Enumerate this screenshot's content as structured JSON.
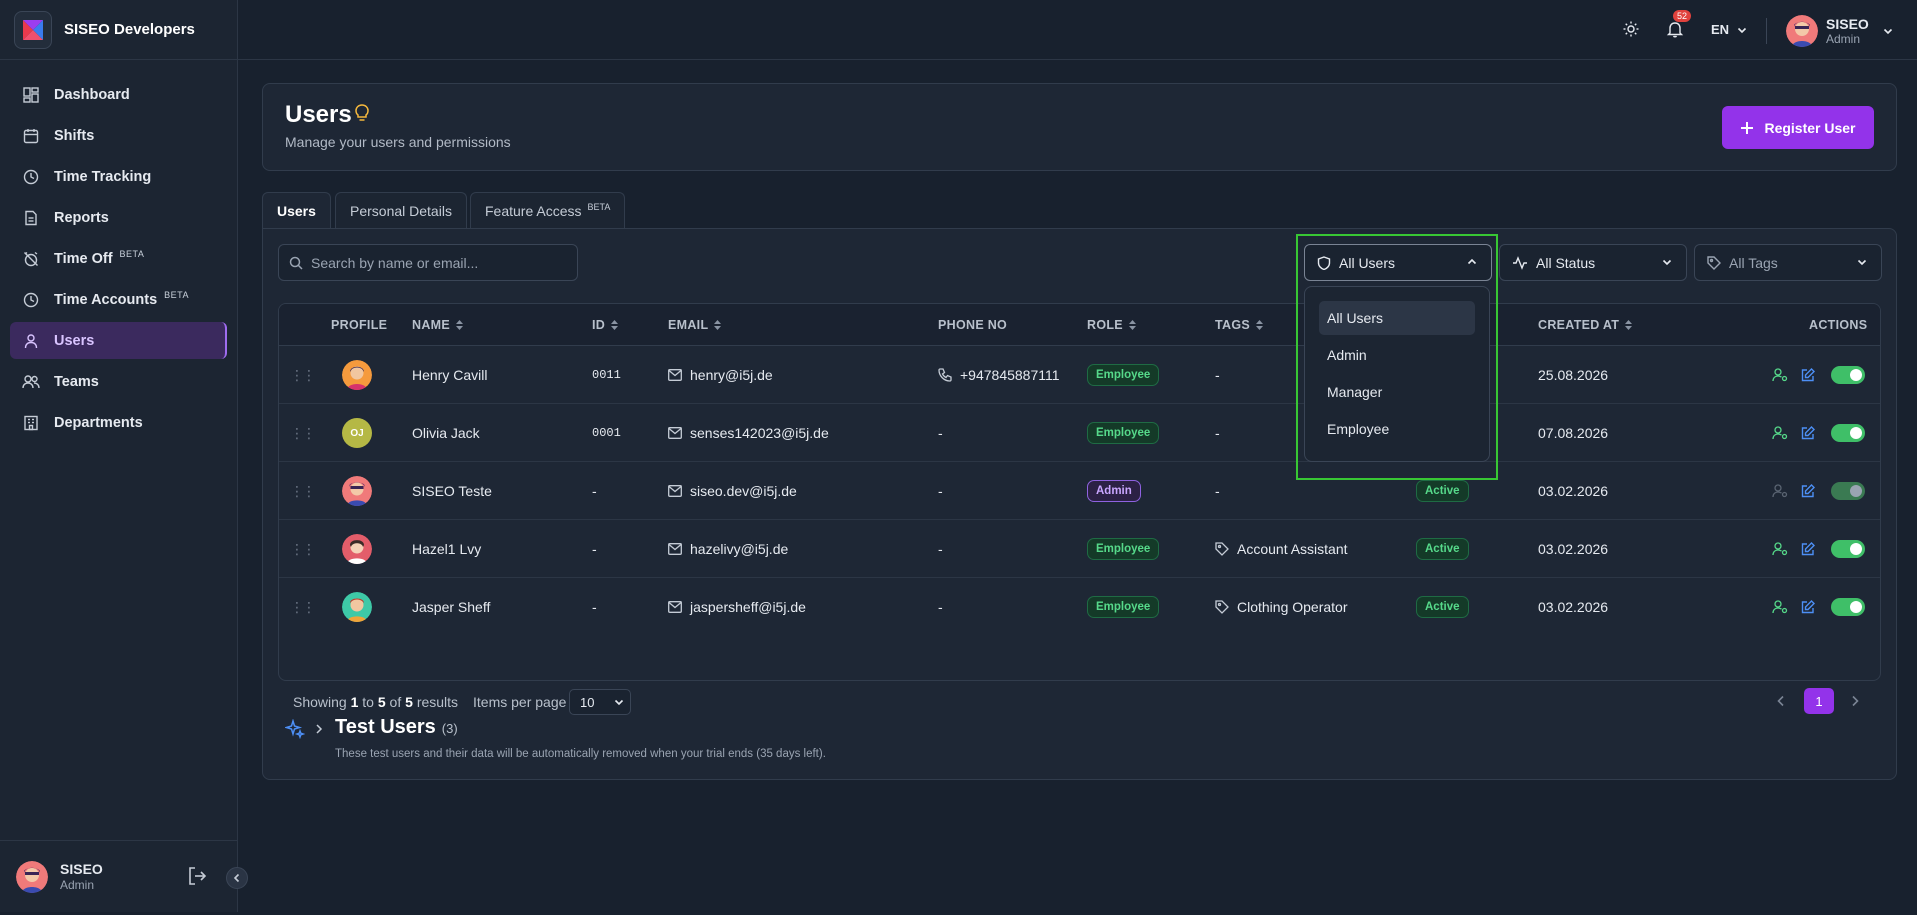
{
  "app": {
    "name": "SISEO Developers"
  },
  "sidebar": {
    "items": [
      {
        "label": "Dashboard",
        "icon": "grid-icon"
      },
      {
        "label": "Shifts",
        "icon": "calendar-icon"
      },
      {
        "label": "Time Tracking",
        "icon": "clock-icon"
      },
      {
        "label": "Reports",
        "icon": "file-icon"
      },
      {
        "label": "Time Off",
        "badge": "BETA",
        "icon": "alarm-off-icon"
      },
      {
        "label": "Time Accounts",
        "badge": "BETA",
        "icon": "clock-icon"
      },
      {
        "label": "Users",
        "icon": "user-icon",
        "active": true
      },
      {
        "label": "Teams",
        "icon": "users-icon"
      },
      {
        "label": "Departments",
        "icon": "building-icon"
      }
    ],
    "footer": {
      "name": "SISEO",
      "role": "Admin"
    }
  },
  "topbar": {
    "notifications": "52",
    "language": "EN",
    "user": {
      "name": "SISEO",
      "role": "Admin"
    }
  },
  "header": {
    "title": "Users",
    "subtitle": "Manage your users and permissions",
    "register_label": "Register User"
  },
  "tabs": [
    {
      "label": "Users",
      "active": true
    },
    {
      "label": "Personal Details"
    },
    {
      "label": "Feature Access",
      "badge": "BETA"
    }
  ],
  "filters": {
    "search_placeholder": "Search by name or email...",
    "role": "All Users",
    "status": "All Status",
    "tags": "All Tags"
  },
  "role_dropdown": {
    "options": [
      "All Users",
      "Admin",
      "Manager",
      "Employee"
    ],
    "selected": "All Users"
  },
  "table": {
    "columns": {
      "profile": "PROFILE",
      "name": "NAME",
      "id": "ID",
      "email": "EMAIL",
      "phone": "PHONE NO",
      "role": "ROLE",
      "tags": "TAGS",
      "created": "CREATED AT",
      "actions": "ACTIONS"
    },
    "rows": [
      {
        "name": "Henry Cavill",
        "id": "0011",
        "email": "henry@i5j.de",
        "phone": "+947845887111",
        "role": "Employee",
        "tags": "-",
        "status": "",
        "created": "25.08.2026"
      },
      {
        "name": "Olivia Jack",
        "initials": "OJ",
        "id": "0001",
        "email": "senses142023@i5j.de",
        "phone": "-",
        "role": "Employee",
        "tags": "-",
        "status": "",
        "created": "07.08.2026"
      },
      {
        "name": "SISEO Teste",
        "id": "-",
        "email": "siseo.dev@i5j.de",
        "phone": "-",
        "role": "Admin",
        "tags": "-",
        "status": "Active",
        "created": "03.02.2026"
      },
      {
        "name": "Hazel1 Lvy",
        "id": "-",
        "email": "hazelivy@i5j.de",
        "phone": "-",
        "role": "Employee",
        "tags": "Account Assistant",
        "status": "Active",
        "created": "03.02.2026"
      },
      {
        "name": "Jasper Sheff",
        "id": "-",
        "email": "jaspersheff@i5j.de",
        "phone": "-",
        "role": "Employee",
        "tags": "Clothing Operator",
        "status": "Active",
        "created": "03.02.2026"
      }
    ]
  },
  "pagination": {
    "showing": "Showing",
    "from": "1",
    "to_word": "to",
    "to": "5",
    "of_word": "of",
    "total": "5",
    "results": "results",
    "items_per_page_label": "Items per page",
    "items_per_page": "10",
    "current_page": "1"
  },
  "test_users": {
    "title": "Test Users",
    "count": "(3)",
    "description": "These test users and their data will be automatically removed when your trial ends (35 days left)."
  },
  "colors": {
    "accent": "#9333ea",
    "active_green": "#56d98a",
    "highlight": "#38c734"
  }
}
